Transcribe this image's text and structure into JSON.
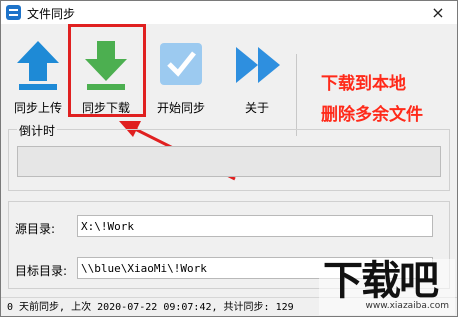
{
  "window": {
    "title": "文件同步",
    "close": "×"
  },
  "toolbar": {
    "upload_label": "同步上传",
    "download_label": "同步下载",
    "start_label": "开始同步",
    "about_label": "关于"
  },
  "annotation": {
    "line1": "下载到本地",
    "line2": "删除多余文件"
  },
  "countdown": {
    "label": "倒计时",
    "progress": 0
  },
  "paths": {
    "source_label": "源目录:",
    "source_value": "X:\\!Work",
    "target_label": "目标目录:",
    "target_value": "\\\\blue\\XiaoMi\\!Work"
  },
  "status": {
    "text": "0 天前同步, 上次 2020-07-22 09:07:42, 共计同步: 129"
  },
  "watermark": {
    "main": "下载吧",
    "sub": "www.xiazaiba.com"
  },
  "colors": {
    "accent_red": "#e02020",
    "icon_blue": "#1e8ad6",
    "icon_green": "#4caf50"
  }
}
